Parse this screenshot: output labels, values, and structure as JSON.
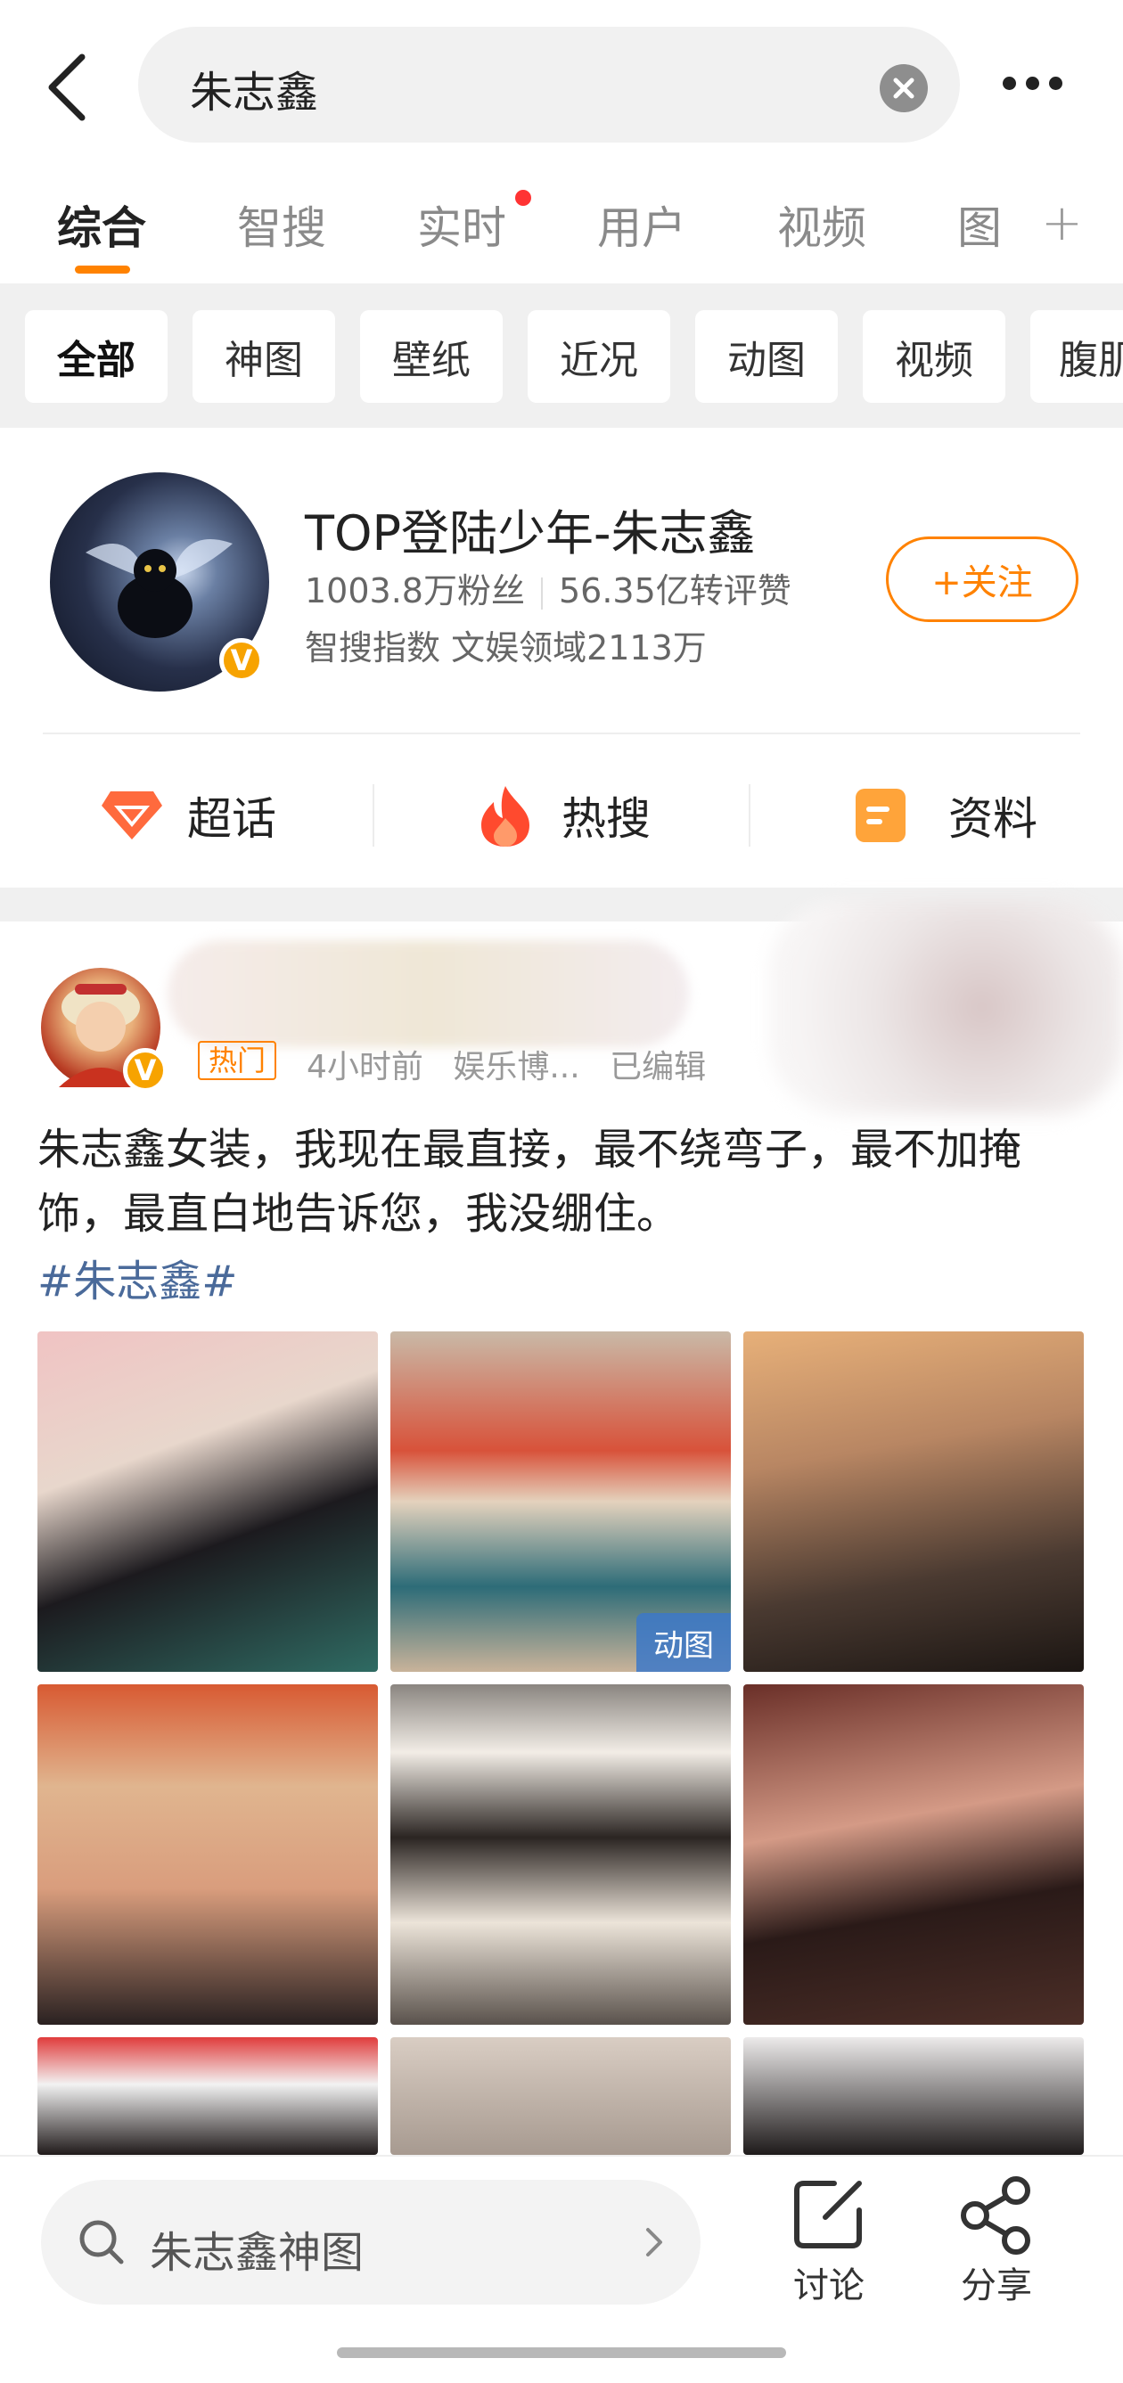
{
  "search": {
    "query": "朱志鑫"
  },
  "tabs": [
    {
      "label": "综合",
      "active": true
    },
    {
      "label": "智搜"
    },
    {
      "label": "实时",
      "has_dot": true
    },
    {
      "label": "用户"
    },
    {
      "label": "视频"
    },
    {
      "label": "图"
    }
  ],
  "filters": [
    "全部",
    "神图",
    "壁纸",
    "近况",
    "动图",
    "视频",
    "腹肌"
  ],
  "profile": {
    "name": "TOP登陆少年-朱志鑫",
    "fans": "1003.8万粉丝",
    "interactions": "56.35亿转评赞",
    "index": "智搜指数 文娱领域2113万",
    "follow_label": "+关注",
    "verified": "V"
  },
  "shortcuts": [
    {
      "label": "超话",
      "icon": "supertopic-icon"
    },
    {
      "label": "热搜",
      "icon": "flame-icon"
    },
    {
      "label": "资料",
      "icon": "profile-doc-icon"
    }
  ],
  "post": {
    "tag": "热门",
    "time": "4小时前",
    "source": "娱乐博...",
    "edited": "已编辑",
    "text": "朱志鑫女装，我现在最直接，最不绕弯子，最不加掩饰，最直白地告诉您，我没绷住。",
    "hashtag": "#朱志鑫#",
    "gif_label": "动图"
  },
  "bottom": {
    "search_text": "朱志鑫神图",
    "discuss_label": "讨论",
    "share_label": "分享"
  },
  "colors": {
    "accent": "#ff8200",
    "link": "#4a6a9a"
  }
}
